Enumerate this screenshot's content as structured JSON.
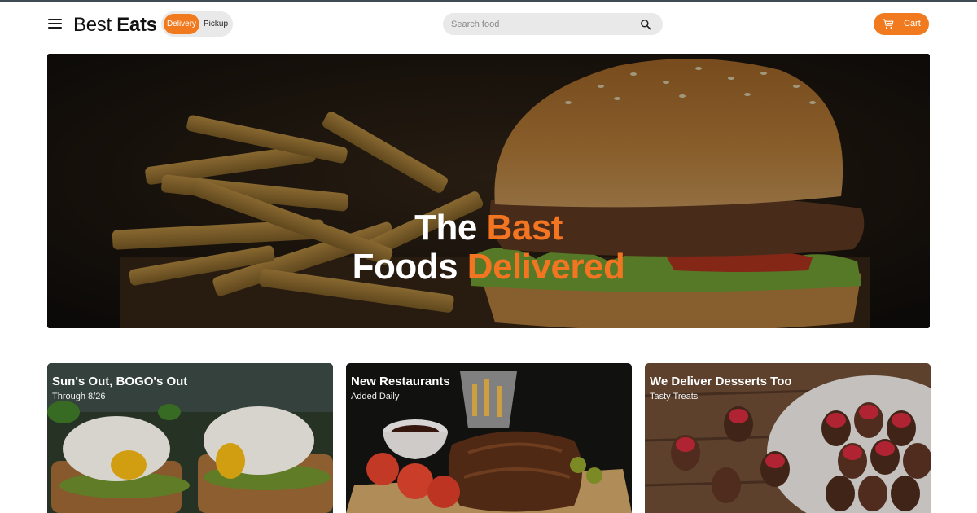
{
  "header": {
    "menu_icon": "hamburger-menu-icon",
    "brand_regular": "Best",
    "brand_bold": "Eats",
    "mode_options": [
      "Delivery",
      "Pickup"
    ],
    "mode_selected": "Delivery",
    "search_placeholder": "Search food",
    "search_icon": "magnifier-search-icon",
    "cart_label": "Cart",
    "cart_icon": "shopping-cart-icon"
  },
  "hero": {
    "line1_white": "The",
    "line1_accent": "Bast",
    "line2_white": "Foods",
    "line2_accent": "Delivered"
  },
  "promos": [
    {
      "title": "Sun's Out, BOGO's Out",
      "subtitle": "Through 8/26"
    },
    {
      "title": "New Restaurants",
      "subtitle": "Added Daily"
    },
    {
      "title": "We Deliver Desserts Too",
      "subtitle": "Tasty Treats"
    }
  ],
  "colors": {
    "accent": "#f07a1d",
    "toggle_bg": "#e9e9ea",
    "top_strip": "#3f4b55"
  }
}
